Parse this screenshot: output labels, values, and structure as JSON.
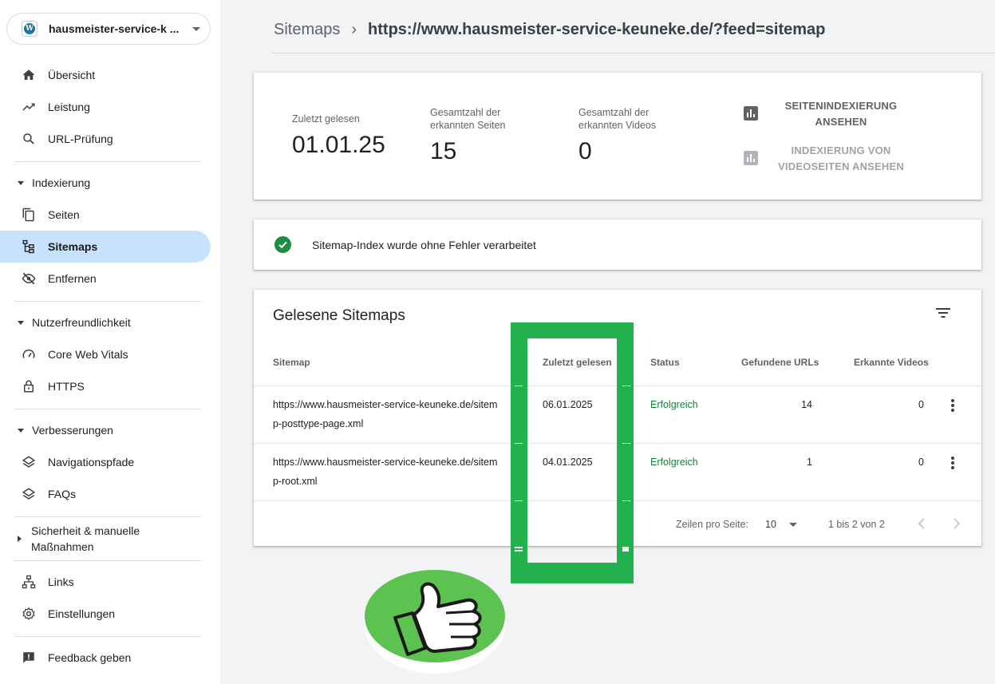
{
  "property": {
    "name": "hausmeister-service-k ...",
    "logo_icon": "wordpress-icon"
  },
  "nav": {
    "overview": "Übersicht",
    "performance": "Leistung",
    "url_inspection": "URL-Prüfung",
    "indexing_section": "Indexierung",
    "pages": "Seiten",
    "sitemaps": "Sitemaps",
    "removals": "Entfernen",
    "experience_section": "Nutzerfreundlichkeit",
    "core_web_vitals": "Core Web Vitals",
    "https": "HTTPS",
    "enhancements_section": "Verbesserungen",
    "breadcrumbs": "Navigationspfade",
    "faqs": "FAQs",
    "security_section_line1": "Sicherheit & manuelle",
    "security_section_line2": "Maßnahmen",
    "links": "Links",
    "settings": "Einstellungen",
    "feedback": "Feedback geben"
  },
  "header": {
    "parent": "Sitemaps",
    "current": "https://www.hausmeister-service-keuneke.de/?feed=sitemap"
  },
  "summary": {
    "last_read_label": "Zuletzt gelesen",
    "last_read_value": "01.01.25",
    "pages_label_line1": "Gesamtzahl der",
    "pages_label_line2": "erkannten Seiten",
    "pages_value": "15",
    "videos_label_line1": "Gesamtzahl der",
    "videos_label_line2": "erkannten Videos",
    "videos_value": "0",
    "page_indexing_line1": "SEITENINDEXIERUNG",
    "page_indexing_line2": "ANSEHEN",
    "video_indexing_line1": "INDEXIERUNG VON",
    "video_indexing_line2": "VIDEOSEITEN ANSEHEN"
  },
  "status_message": "Sitemap-Index wurde ohne Fehler verarbeitet",
  "table": {
    "title": "Gelesene Sitemaps",
    "columns": [
      "Sitemap",
      "Zuletzt gelesen",
      "Status",
      "Gefundene URLs",
      "Erkannte Videos"
    ],
    "rows": [
      {
        "sitemap_line1": "https://www.hausmeister-service-keuneke.de/sitem",
        "sitemap_line2": "p-posttype-page.xml",
        "last_read": "06.01.2025",
        "status": "Erfolgreich",
        "urls": "14",
        "videos": "0"
      },
      {
        "sitemap_line1": "https://www.hausmeister-service-keuneke.de/sitem",
        "sitemap_line2": "p-root.xml",
        "last_read": "04.01.2025",
        "status": "Erfolgreich",
        "urls": "1",
        "videos": "0"
      }
    ],
    "rows_per_page_label": "Zeilen pro Seite:",
    "rows_per_page_value": "10",
    "range": "1 bis 2 von 2"
  },
  "colors": {
    "accent_active": "#c7e2fd",
    "success": "#188038",
    "highlight": "#22b14c",
    "thumb_green": "#5cc250"
  }
}
